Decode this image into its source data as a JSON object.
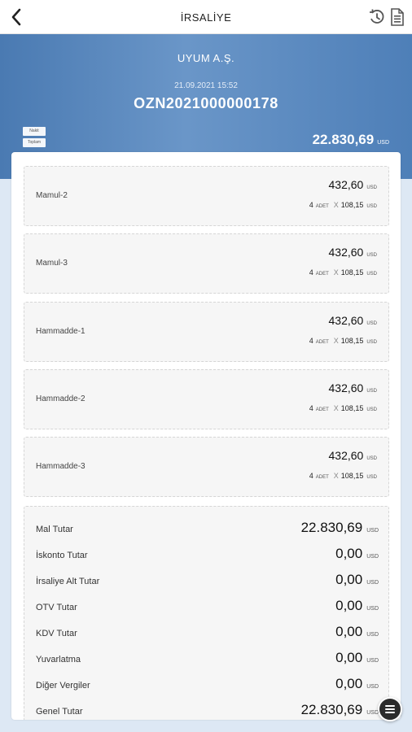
{
  "topbar": {
    "title": "İRSALİYE"
  },
  "header": {
    "company": "UYUM A.Ş.",
    "date": "21.09.2021 15:52",
    "doc_no": "OZN2021000000178",
    "tags": [
      "Nakit",
      "Toplam"
    ],
    "total": "22.830,69",
    "currency": "USD"
  },
  "items": [
    {
      "name": "Mamul-2",
      "amount": "432,60",
      "currency": "USD",
      "qty": "4",
      "unit": "ADET",
      "price": "108,15"
    },
    {
      "name": "Mamul-3",
      "amount": "432,60",
      "currency": "USD",
      "qty": "4",
      "unit": "ADET",
      "price": "108,15"
    },
    {
      "name": "Hammadde-1",
      "amount": "432,60",
      "currency": "USD",
      "qty": "4",
      "unit": "ADET",
      "price": "108,15"
    },
    {
      "name": "Hammadde-2",
      "amount": "432,60",
      "currency": "USD",
      "qty": "4",
      "unit": "ADET",
      "price": "108,15"
    },
    {
      "name": "Hammadde-3",
      "amount": "432,60",
      "currency": "USD",
      "qty": "4",
      "unit": "ADET",
      "price": "108,15"
    }
  ],
  "summary": [
    {
      "label": "Mal Tutar",
      "value": "22.830,69",
      "currency": "USD"
    },
    {
      "label": "İskonto Tutar",
      "value": "0,00",
      "currency": "USD"
    },
    {
      "label": "İrsaliye Alt Tutar",
      "value": "0,00",
      "currency": "USD"
    },
    {
      "label": "OTV Tutar",
      "value": "0,00",
      "currency": "USD"
    },
    {
      "label": "KDV Tutar",
      "value": "0,00",
      "currency": "USD"
    },
    {
      "label": "Yuvarlatma",
      "value": "0,00",
      "currency": "USD"
    },
    {
      "label": "Diğer Vergiler",
      "value": "0,00",
      "currency": "USD"
    },
    {
      "label": "Genel Tutar",
      "value": "22.830,69",
      "currency": "USD"
    }
  ],
  "colors": {
    "header_blue": "#5a88c0",
    "background": "#dde8f4",
    "fab": "#2b2b2b"
  },
  "icons": {
    "back": "chevron-left-icon",
    "history": "history-icon",
    "document": "document-icon",
    "menu": "menu-icon"
  }
}
